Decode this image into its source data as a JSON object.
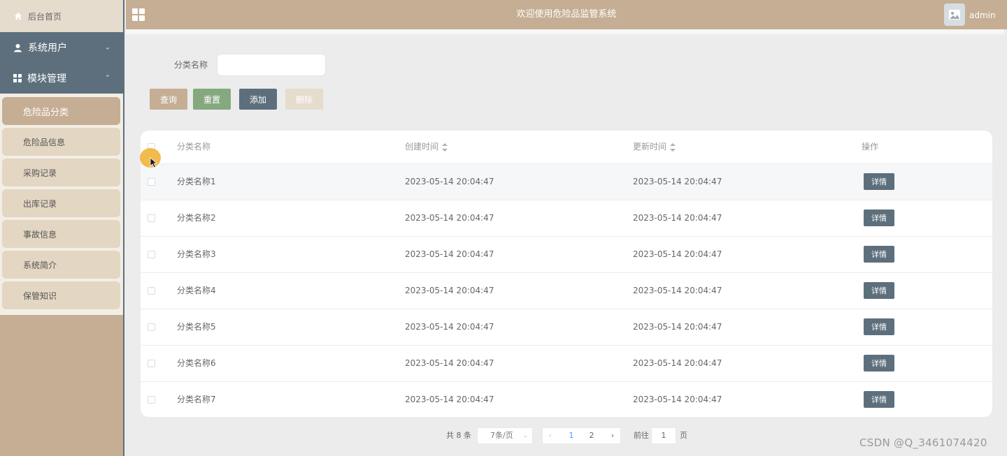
{
  "sidebar": {
    "home": "后台首页",
    "menus": [
      {
        "label": "系统用户",
        "icon": "user-icon",
        "expanded": false
      },
      {
        "label": "模块管理",
        "icon": "grid-icon",
        "expanded": true
      }
    ],
    "items": [
      {
        "label": "危险品分类",
        "active": true
      },
      {
        "label": "危险品信息",
        "active": false
      },
      {
        "label": "采购记录",
        "active": false
      },
      {
        "label": "出库记录",
        "active": false
      },
      {
        "label": "事故信息",
        "active": false
      },
      {
        "label": "系统简介",
        "active": false
      },
      {
        "label": "保管知识",
        "active": false
      }
    ]
  },
  "header": {
    "title": "欢迎使用危险品监管系统",
    "username": "admin"
  },
  "search": {
    "label": "分类名称",
    "value": "",
    "placeholder": ""
  },
  "buttons": {
    "query": "查询",
    "reset": "重置",
    "add": "添加",
    "delete": "删除"
  },
  "table": {
    "columns": [
      "分类名称",
      "创建时间",
      "更新时间",
      "操作"
    ],
    "detail_label": "详情",
    "rows": [
      {
        "name": "分类名称1",
        "created": "2023-05-14 20:04:47",
        "updated": "2023-05-14 20:04:47"
      },
      {
        "name": "分类名称2",
        "created": "2023-05-14 20:04:47",
        "updated": "2023-05-14 20:04:47"
      },
      {
        "name": "分类名称3",
        "created": "2023-05-14 20:04:47",
        "updated": "2023-05-14 20:04:47"
      },
      {
        "name": "分类名称4",
        "created": "2023-05-14 20:04:47",
        "updated": "2023-05-14 20:04:47"
      },
      {
        "name": "分类名称5",
        "created": "2023-05-14 20:04:47",
        "updated": "2023-05-14 20:04:47"
      },
      {
        "name": "分类名称6",
        "created": "2023-05-14 20:04:47",
        "updated": "2023-05-14 20:04:47"
      },
      {
        "name": "分类名称7",
        "created": "2023-05-14 20:04:47",
        "updated": "2023-05-14 20:04:47"
      }
    ]
  },
  "pagination": {
    "total": "共 8 条",
    "page_size": "7条/页",
    "pages": [
      "1",
      "2"
    ],
    "current": "1",
    "goto_label": "前往",
    "goto_value": "1",
    "goto_unit": "页"
  },
  "watermark": "CSDN @Q_3461074420",
  "colors": {
    "primary": "#c5ae94",
    "dark": "#5d6f7c",
    "green": "#86a87f",
    "light": "#e6dccd"
  }
}
